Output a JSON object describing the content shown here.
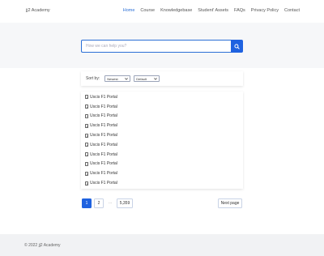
{
  "header": {
    "brand": "jj2 Academy",
    "nav": [
      {
        "label": "Home",
        "active": true
      },
      {
        "label": "Course",
        "active": false
      },
      {
        "label": "Knowledgebase",
        "active": false
      },
      {
        "label": "Student' Assets",
        "active": false
      },
      {
        "label": "FAQs",
        "active": false
      },
      {
        "label": "Privacy Policy",
        "active": false
      },
      {
        "label": "Contact",
        "active": false
      }
    ]
  },
  "search": {
    "placeholder": "How we can help you?",
    "icon": "search-icon",
    "accent": "#1f62e0"
  },
  "sort": {
    "label": "Sort by:",
    "order_value": "Newest",
    "filter_value": "Default"
  },
  "results": [
    "Uscis F1 Portal",
    "Uscis F1 Portal",
    "Uscis F1 Portal",
    "Uscis F1 Portal",
    "Uscis F1 Portal",
    "Uscis F1 Portal",
    "Uscis F1 Portal",
    "Uscis F1 Portal",
    "Uscis F1 Portal",
    "Uscis F1 Portal"
  ],
  "pagination": {
    "pages": [
      "1",
      "2"
    ],
    "ellipsis": "...",
    "last_page": "5,359",
    "next_label": "Next page",
    "current": "1"
  },
  "footer": {
    "copyright": "© 2022 jj2 Academy"
  }
}
